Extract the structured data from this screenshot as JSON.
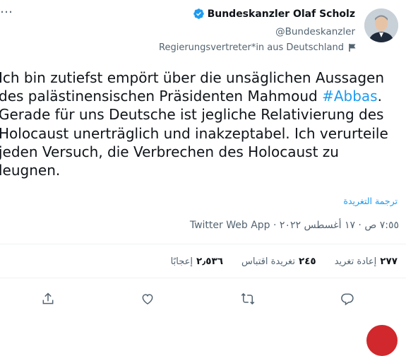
{
  "tweet": {
    "more_label": "…",
    "author": {
      "display_name": "Bundeskanzler Olaf Scholz",
      "handle": "@Bundeskanzler",
      "government_label": "Regierungsvertreter*in aus Deutschland"
    },
    "text_before": "Ich bin zutiefst empört über die unsäglichen Aussagen\ndes palästinensischen Präsidenten Mahmoud ",
    "hashtag": "#Abbas",
    "text_after": ".\nGerade für uns Deutsche ist jegliche Relativierung des\nHolocaust unerträglich und inakzeptabel. Ich verurteile\njeden Versuch, die Verbrechen des Holocaust zu\nleugnen.",
    "translate_label": "ترجمة التغريدة",
    "timestamp": "٧:٥٥ ص · ١٧ أغسطس ٢٠٢٢ · ",
    "source_app": "Twitter Web App",
    "stats": {
      "retweets": {
        "count": "٢٧٧",
        "label": "إعادة تغريد"
      },
      "quotes": {
        "count": "٢٤٥",
        "label": "تغريدة اقتباس"
      },
      "likes": {
        "count": "٢٫٥٣٦",
        "label": "إعجابًا"
      }
    },
    "colors": {
      "accent": "#1d9bf0",
      "secondary_text": "#536471",
      "divider": "#eff3f4"
    }
  }
}
